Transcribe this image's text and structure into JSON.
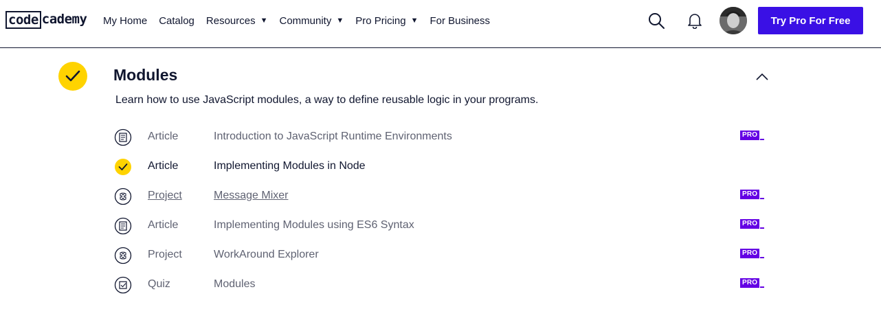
{
  "header": {
    "logo_part1": "code",
    "logo_part2": "cademy",
    "nav": [
      {
        "label": "My Home",
        "dropdown": false
      },
      {
        "label": "Catalog",
        "dropdown": false
      },
      {
        "label": "Resources",
        "dropdown": true
      },
      {
        "label": "Community",
        "dropdown": true
      },
      {
        "label": "Pro Pricing",
        "dropdown": true
      },
      {
        "label": "For Business",
        "dropdown": false
      }
    ],
    "cta_label": "Try Pro For Free"
  },
  "module": {
    "title": "Modules",
    "description": "Learn how to use JavaScript modules, a way to define reusable logic in your programs.",
    "items": [
      {
        "type": "Article",
        "title": "Introduction to JavaScript Runtime Environments",
        "icon": "article-icon",
        "pro": "PRO",
        "state": "normal"
      },
      {
        "type": "Article",
        "title": "Implementing Modules in Node",
        "icon": "check-icon",
        "pro": "",
        "state": "done"
      },
      {
        "type": "Project",
        "title": "Message Mixer",
        "icon": "project-icon",
        "pro": "PRO",
        "state": "link"
      },
      {
        "type": "Article",
        "title": "Implementing Modules using ES6 Syntax",
        "icon": "article-icon",
        "pro": "PRO",
        "state": "normal"
      },
      {
        "type": "Project",
        "title": "WorkAround Explorer",
        "icon": "project-icon",
        "pro": "PRO",
        "state": "normal"
      },
      {
        "type": "Quiz",
        "title": "Modules",
        "icon": "quiz-icon",
        "pro": "PRO",
        "state": "normal"
      }
    ]
  },
  "colors": {
    "accent": "#3a10e5",
    "pro_badge": "#6400e4",
    "complete": "#ffd300",
    "text": "#10162f",
    "muted": "#5f6272"
  }
}
